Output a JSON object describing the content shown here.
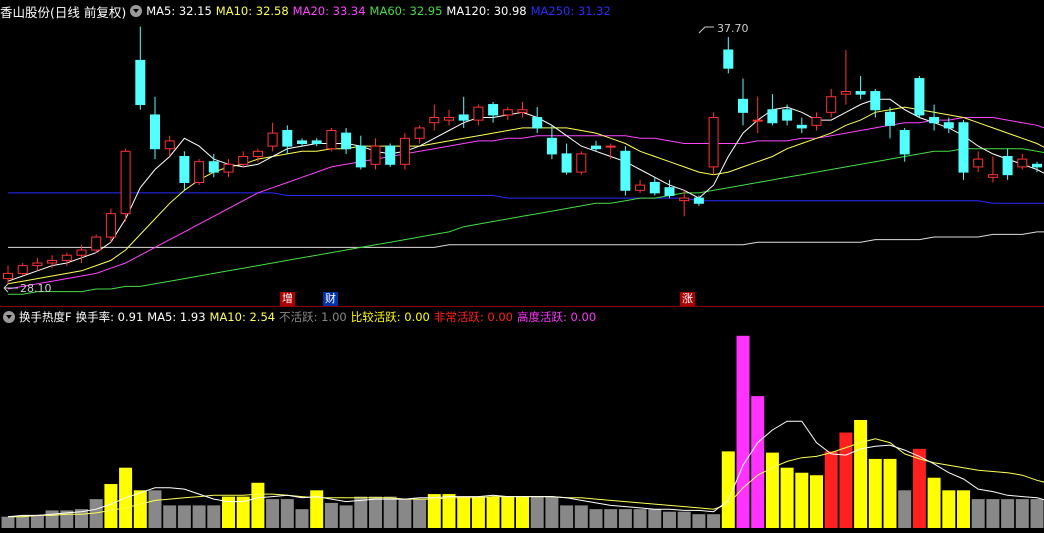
{
  "main_legend": {
    "title": "香山股份(日线 前复权)",
    "items": [
      {
        "label": "MA5: 32.15",
        "color": "#ffffff"
      },
      {
        "label": "MA10: 32.58",
        "color": "#ffff55"
      },
      {
        "label": "MA20: 33.34",
        "color": "#ff44ff"
      },
      {
        "label": "MA60: 32.95",
        "color": "#44dd44"
      },
      {
        "label": "MA120: 30.98",
        "color": "#ffffff"
      },
      {
        "label": "MA250: 31.32",
        "color": "#2222ff"
      }
    ]
  },
  "sub_legend": {
    "title": "换手热度F",
    "items": [
      {
        "label": "换手率: 0.91",
        "color": "#ffffff"
      },
      {
        "label": "MA5: 1.93",
        "color": "#ffffff"
      },
      {
        "label": "MA10: 2.54",
        "color": "#ffff55"
      },
      {
        "label": "不活跃: 1.00",
        "color": "#888888"
      },
      {
        "label": "比较活跃: 0.00",
        "color": "#ffff00"
      },
      {
        "label": "非常活跃: 0.00",
        "color": "#ff2020"
      },
      {
        "label": "高度活跃: 0.00",
        "color": "#ff33ff"
      }
    ]
  },
  "annotations": {
    "high": "37.70",
    "low": "28.10",
    "tags": [
      {
        "text": "增",
        "bg": "#aa0000",
        "color": "#ffffff"
      },
      {
        "text": "财",
        "bg": "#0033aa",
        "color": "#ffffff"
      },
      {
        "text": "涨",
        "bg": "#aa0000",
        "color": "#ffffff"
      }
    ]
  },
  "colors": {
    "up": "#ff3333",
    "down": "#54ffff",
    "bg": "#000000"
  },
  "chart_data": [
    {
      "type": "candlestick",
      "ylim": [
        27.5,
        38.2
      ],
      "candles": [
        [
          28.4,
          28.9,
          28.2,
          28.6
        ],
        [
          28.6,
          29.0,
          28.5,
          28.9
        ],
        [
          28.9,
          29.2,
          28.7,
          29.0
        ],
        [
          29.0,
          29.3,
          28.8,
          29.1
        ],
        [
          29.1,
          29.4,
          28.9,
          29.3
        ],
        [
          29.3,
          29.7,
          29.0,
          29.5
        ],
        [
          29.5,
          30.1,
          29.4,
          30.0
        ],
        [
          30.0,
          31.1,
          29.8,
          30.9
        ],
        [
          30.9,
          33.4,
          30.6,
          33.3
        ],
        [
          36.8,
          38.1,
          34.9,
          35.1
        ],
        [
          34.7,
          35.4,
          33.0,
          33.4
        ],
        [
          33.4,
          33.9,
          33.1,
          33.7
        ],
        [
          33.1,
          33.3,
          31.8,
          32.1
        ],
        [
          32.1,
          33.0,
          32.0,
          32.9
        ],
        [
          32.9,
          33.2,
          32.3,
          32.5
        ],
        [
          32.5,
          33.0,
          32.3,
          32.8
        ],
        [
          32.8,
          33.3,
          32.7,
          33.1
        ],
        [
          33.1,
          33.4,
          32.9,
          33.3
        ],
        [
          33.5,
          34.4,
          33.3,
          34.0
        ],
        [
          34.1,
          34.3,
          33.2,
          33.5
        ],
        [
          33.7,
          33.8,
          33.5,
          33.6
        ],
        [
          33.7,
          33.8,
          33.5,
          33.6
        ],
        [
          33.4,
          34.2,
          33.3,
          34.1
        ],
        [
          34.0,
          34.2,
          33.2,
          33.4
        ],
        [
          33.5,
          33.9,
          32.6,
          32.7
        ],
        [
          32.8,
          33.8,
          32.6,
          33.5
        ],
        [
          33.5,
          33.6,
          32.7,
          32.8
        ],
        [
          32.8,
          34.0,
          32.6,
          33.8
        ],
        [
          33.8,
          34.3,
          33.6,
          34.2
        ],
        [
          34.4,
          35.1,
          34.1,
          34.6
        ],
        [
          34.5,
          34.9,
          34.3,
          34.6
        ],
        [
          34.7,
          35.4,
          34.2,
          34.5
        ],
        [
          34.5,
          35.1,
          34.3,
          35.0
        ],
        [
          35.1,
          35.2,
          34.4,
          34.7
        ],
        [
          34.7,
          35.0,
          34.5,
          34.9
        ],
        [
          34.8,
          35.2,
          34.6,
          34.9
        ],
        [
          34.6,
          35.0,
          34.0,
          34.2
        ],
        [
          33.8,
          34.3,
          33.0,
          33.2
        ],
        [
          33.2,
          33.6,
          32.4,
          32.5
        ],
        [
          32.5,
          33.3,
          32.4,
          33.2
        ],
        [
          33.5,
          33.7,
          33.3,
          33.4
        ],
        [
          33.5,
          33.6,
          33.0,
          33.5
        ],
        [
          33.3,
          33.5,
          31.6,
          31.8
        ],
        [
          31.8,
          32.2,
          31.7,
          32.0
        ],
        [
          32.1,
          32.3,
          31.6,
          31.7
        ],
        [
          31.9,
          32.2,
          31.5,
          31.6
        ],
        [
          31.4,
          31.8,
          30.8,
          31.5
        ],
        [
          31.5,
          31.6,
          31.2,
          31.3
        ],
        [
          32.7,
          34.8,
          32.4,
          34.6
        ],
        [
          37.2,
          37.7,
          36.3,
          36.5
        ],
        [
          35.3,
          36.1,
          34.3,
          34.8
        ],
        [
          34.5,
          35.4,
          34.0,
          34.5
        ],
        [
          34.9,
          35.5,
          34.3,
          34.4
        ],
        [
          34.9,
          35.1,
          34.3,
          34.5
        ],
        [
          34.3,
          34.6,
          34.0,
          34.2
        ],
        [
          34.3,
          34.8,
          34.1,
          34.6
        ],
        [
          34.8,
          35.7,
          34.6,
          35.4
        ],
        [
          35.5,
          37.2,
          35.1,
          35.6
        ],
        [
          35.6,
          36.2,
          35.3,
          35.5
        ],
        [
          35.6,
          35.7,
          34.6,
          34.9
        ],
        [
          34.8,
          35.0,
          33.8,
          34.3
        ],
        [
          34.1,
          34.2,
          32.9,
          33.2
        ],
        [
          36.1,
          36.2,
          34.6,
          34.7
        ],
        [
          34.6,
          35.1,
          34.1,
          34.4
        ],
        [
          34.4,
          34.6,
          34.0,
          34.2
        ],
        [
          34.4,
          34.5,
          32.2,
          32.5
        ],
        [
          32.7,
          33.3,
          32.5,
          33.0
        ],
        [
          32.3,
          33.1,
          32.1,
          32.4
        ],
        [
          33.1,
          33.4,
          32.2,
          32.4
        ],
        [
          32.7,
          33.2,
          32.6,
          33.0
        ],
        [
          32.8,
          32.9,
          32.5,
          32.7
        ],
        [
          32.4,
          32.5,
          31.2,
          31.4
        ],
        [
          31.3,
          31.6,
          30.8,
          31.4
        ]
      ],
      "ma5": [
        28.3,
        28.5,
        28.7,
        28.9,
        29.0,
        29.2,
        29.4,
        29.8,
        30.7,
        31.9,
        32.6,
        33.1,
        33.8,
        33.5,
        33.0,
        32.8,
        32.7,
        32.8,
        33.1,
        33.4,
        33.5,
        33.6,
        33.6,
        33.6,
        33.5,
        33.3,
        33.2,
        33.3,
        33.5,
        33.8,
        34.1,
        34.4,
        34.6,
        34.6,
        34.7,
        34.8,
        34.6,
        34.3,
        33.9,
        33.5,
        33.3,
        33.1,
        32.9,
        32.6,
        32.3,
        32.0,
        31.8,
        31.5,
        32.0,
        33.1,
        34.0,
        34.5,
        34.9,
        35.0,
        34.8,
        34.5,
        34.5,
        34.8,
        35.1,
        35.3,
        35.3,
        34.9,
        34.6,
        34.4,
        34.2,
        33.9,
        33.5,
        33.2,
        33.0,
        32.8,
        32.6,
        32.3,
        32.1
      ],
      "ma10": [
        28.2,
        28.3,
        28.4,
        28.5,
        28.6,
        28.7,
        28.9,
        29.1,
        29.5,
        30.1,
        30.7,
        31.3,
        31.8,
        32.2,
        32.5,
        32.7,
        32.8,
        33.0,
        33.1,
        33.2,
        33.3,
        33.3,
        33.4,
        33.4,
        33.5,
        33.5,
        33.5,
        33.5,
        33.5,
        33.6,
        33.7,
        33.8,
        33.9,
        34.0,
        34.1,
        34.2,
        34.2,
        34.2,
        34.2,
        34.1,
        34.0,
        33.8,
        33.6,
        33.3,
        33.1,
        32.9,
        32.7,
        32.5,
        32.4,
        32.5,
        32.7,
        32.9,
        33.1,
        33.4,
        33.6,
        33.8,
        34.0,
        34.3,
        34.5,
        34.8,
        34.9,
        35.0,
        34.9,
        34.8,
        34.7,
        34.6,
        34.4,
        34.2,
        34.0,
        33.8,
        33.6,
        33.3,
        33.0
      ],
      "ma20": [
        28.0,
        28.1,
        28.2,
        28.3,
        28.4,
        28.5,
        28.6,
        28.8,
        29.0,
        29.3,
        29.6,
        29.9,
        30.2,
        30.5,
        30.8,
        31.1,
        31.4,
        31.7,
        31.9,
        32.1,
        32.3,
        32.5,
        32.7,
        32.8,
        32.9,
        33.0,
        33.1,
        33.2,
        33.3,
        33.4,
        33.5,
        33.6,
        33.7,
        33.7,
        33.8,
        33.8,
        33.9,
        33.9,
        33.9,
        33.9,
        33.9,
        33.9,
        33.9,
        33.8,
        33.8,
        33.7,
        33.6,
        33.6,
        33.6,
        33.6,
        33.6,
        33.7,
        33.7,
        33.7,
        33.8,
        33.8,
        33.9,
        34.0,
        34.1,
        34.2,
        34.3,
        34.4,
        34.4,
        34.5,
        34.5,
        34.6,
        34.6,
        34.6,
        34.5,
        34.4,
        34.3,
        34.1,
        33.9
      ],
      "ma60": [
        27.8,
        27.8,
        27.9,
        27.9,
        27.9,
        27.9,
        28.0,
        28.0,
        28.1,
        28.1,
        28.2,
        28.3,
        28.4,
        28.5,
        28.6,
        28.7,
        28.8,
        28.9,
        29.0,
        29.1,
        29.2,
        29.3,
        29.4,
        29.5,
        29.6,
        29.7,
        29.8,
        29.9,
        30.0,
        30.1,
        30.2,
        30.4,
        30.5,
        30.6,
        30.7,
        30.8,
        30.9,
        31.0,
        31.1,
        31.2,
        31.3,
        31.3,
        31.4,
        31.5,
        31.5,
        31.6,
        31.7,
        31.7,
        31.8,
        31.9,
        32.0,
        32.1,
        32.2,
        32.3,
        32.4,
        32.5,
        32.6,
        32.7,
        32.8,
        32.9,
        33.0,
        33.1,
        33.2,
        33.3,
        33.3,
        33.4,
        33.4,
        33.4,
        33.4,
        33.4,
        33.3,
        33.2,
        33.0
      ],
      "ma120": [
        29.6,
        29.6,
        29.6,
        29.6,
        29.6,
        29.6,
        29.6,
        29.6,
        29.6,
        29.6,
        29.6,
        29.6,
        29.6,
        29.6,
        29.6,
        29.6,
        29.6,
        29.6,
        29.6,
        29.6,
        29.6,
        29.6,
        29.6,
        29.6,
        29.6,
        29.6,
        29.6,
        29.6,
        29.6,
        29.6,
        29.7,
        29.7,
        29.7,
        29.7,
        29.7,
        29.7,
        29.7,
        29.7,
        29.7,
        29.7,
        29.7,
        29.7,
        29.7,
        29.7,
        29.7,
        29.7,
        29.7,
        29.7,
        29.7,
        29.7,
        29.7,
        29.8,
        29.8,
        29.8,
        29.8,
        29.8,
        29.8,
        29.8,
        29.8,
        29.9,
        29.9,
        29.9,
        29.9,
        30.0,
        30.0,
        30.0,
        30.0,
        30.1,
        30.1,
        30.1,
        30.2,
        30.2,
        30.2
      ],
      "ma250": [
        31.7,
        31.7,
        31.7,
        31.7,
        31.7,
        31.7,
        31.7,
        31.7,
        31.7,
        31.7,
        31.7,
        31.7,
        31.7,
        31.7,
        31.7,
        31.7,
        31.7,
        31.7,
        31.7,
        31.6,
        31.6,
        31.6,
        31.6,
        31.6,
        31.6,
        31.6,
        31.6,
        31.6,
        31.6,
        31.6,
        31.6,
        31.6,
        31.6,
        31.6,
        31.5,
        31.5,
        31.5,
        31.5,
        31.5,
        31.5,
        31.5,
        31.5,
        31.5,
        31.5,
        31.5,
        31.5,
        31.5,
        31.4,
        31.4,
        31.4,
        31.4,
        31.4,
        31.4,
        31.4,
        31.4,
        31.4,
        31.4,
        31.4,
        31.4,
        31.4,
        31.4,
        31.4,
        31.4,
        31.4,
        31.4,
        31.4,
        31.4,
        31.3,
        31.3,
        31.3,
        31.3,
        31.3,
        31.3
      ]
    },
    {
      "type": "bar",
      "ylim": [
        0,
        16
      ],
      "values": [
        0.9,
        1.0,
        1.0,
        1.4,
        1.4,
        1.5,
        2.3,
        3.5,
        4.8,
        3.0,
        3.0,
        1.8,
        1.8,
        1.8,
        1.8,
        2.5,
        2.5,
        3.6,
        2.3,
        2.3,
        1.5,
        3.0,
        2.0,
        1.8,
        2.5,
        2.5,
        2.5,
        2.3,
        2.3,
        2.7,
        2.7,
        2.5,
        2.5,
        2.5,
        2.5,
        2.5,
        2.5,
        2.5,
        1.8,
        1.8,
        1.5,
        1.5,
        1.5,
        1.5,
        1.5,
        1.3,
        1.3,
        1.1,
        1.1,
        6.1,
        15.3,
        10.5,
        6.0,
        4.8,
        4.4,
        4.2,
        6.1,
        7.6,
        8.6,
        5.5,
        5.5,
        3.0,
        6.3,
        4.0,
        3.0,
        3.0,
        2.3,
        2.3,
        2.3,
        2.3,
        2.3,
        1.4,
        0.9
      ],
      "categories_by_color": [
        "#888888",
        "#ffff00",
        "#ff2020",
        "#ff33ff"
      ],
      "colors": [
        "#888888",
        "#888888",
        "#888888",
        "#888888",
        "#888888",
        "#888888",
        "#888888",
        "#ffff00",
        "#ffff00",
        "#ffff00",
        "#888888",
        "#888888",
        "#888888",
        "#888888",
        "#888888",
        "#ffff00",
        "#ffff00",
        "#ffff00",
        "#888888",
        "#888888",
        "#888888",
        "#ffff00",
        "#888888",
        "#888888",
        "#888888",
        "#888888",
        "#888888",
        "#888888",
        "#888888",
        "#ffff00",
        "#ffff00",
        "#ffff00",
        "#ffff00",
        "#ffff00",
        "#ffff00",
        "#ffff00",
        "#888888",
        "#888888",
        "#888888",
        "#888888",
        "#888888",
        "#888888",
        "#888888",
        "#888888",
        "#888888",
        "#888888",
        "#888888",
        "#888888",
        "#888888",
        "#ffff00",
        "#ff33ff",
        "#ff33ff",
        "#ffff00",
        "#ffff00",
        "#ffff00",
        "#ffff00",
        "#ff2020",
        "#ff2020",
        "#ffff00",
        "#ffff00",
        "#ffff00",
        "#888888",
        "#ff2020",
        "#ffff00",
        "#ffff00",
        "#ffff00",
        "#888888",
        "#888888",
        "#888888",
        "#888888",
        "#888888",
        "#888888",
        "#888888"
      ],
      "ma5": [
        0.9,
        1.0,
        1.0,
        1.1,
        1.2,
        1.3,
        1.5,
        1.9,
        2.4,
        2.8,
        3.2,
        3.2,
        3.1,
        2.7,
        2.3,
        2.1,
        2.1,
        2.4,
        2.5,
        2.6,
        2.4,
        2.5,
        2.3,
        2.1,
        2.2,
        2.3,
        2.3,
        2.3,
        2.4,
        2.4,
        2.5,
        2.5,
        2.5,
        2.6,
        2.5,
        2.5,
        2.5,
        2.5,
        2.4,
        2.2,
        2.0,
        1.8,
        1.7,
        1.6,
        1.5,
        1.5,
        1.4,
        1.4,
        1.3,
        2.2,
        5.0,
        6.8,
        7.8,
        8.5,
        8.5,
        6.8,
        5.9,
        5.8,
        6.3,
        6.5,
        6.6,
        6.2,
        5.7,
        5.1,
        4.4,
        3.9,
        3.1,
        2.9,
        2.6,
        2.5,
        2.4,
        2.1,
        1.9
      ],
      "ma10": [
        0.9,
        0.9,
        1.0,
        1.0,
        1.1,
        1.1,
        1.2,
        1.4,
        1.6,
        1.9,
        2.2,
        2.3,
        2.4,
        2.5,
        2.6,
        2.6,
        2.6,
        2.7,
        2.7,
        2.6,
        2.5,
        2.4,
        2.4,
        2.4,
        2.4,
        2.4,
        2.4,
        2.3,
        2.3,
        2.3,
        2.4,
        2.4,
        2.4,
        2.5,
        2.5,
        2.5,
        2.5,
        2.5,
        2.4,
        2.4,
        2.3,
        2.2,
        2.1,
        2.0,
        1.9,
        1.8,
        1.7,
        1.6,
        1.5,
        1.9,
        3.2,
        4.2,
        4.8,
        5.3,
        5.6,
        5.7,
        6.0,
        6.4,
        6.8,
        7.1,
        6.8,
        5.9,
        5.5,
        5.2,
        5.0,
        4.8,
        4.6,
        4.5,
        4.4,
        4.2,
        3.8,
        3.5,
        3.0
      ]
    }
  ]
}
